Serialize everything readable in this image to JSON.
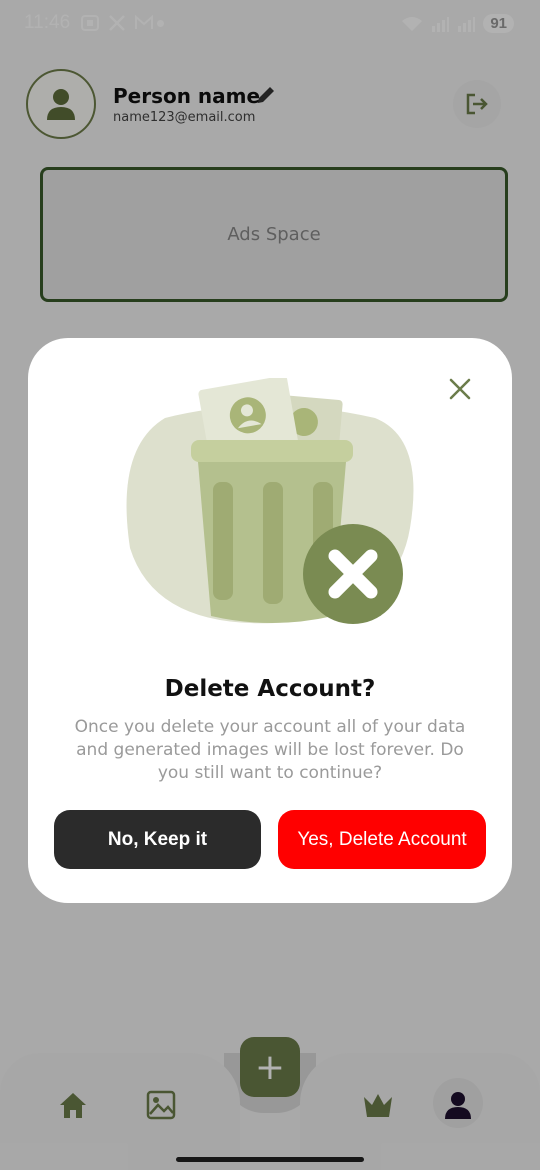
{
  "status_bar": {
    "time": "11:46",
    "battery": "91"
  },
  "profile": {
    "name": "Person name",
    "email": "name123@email.com"
  },
  "ads": {
    "label": "Ads Space"
  },
  "dialog": {
    "title": "Delete Account?",
    "message": "Once you delete your account all of your data and generated images will be lost forever. Do you still want to continue?",
    "keep_label": "No, Keep it",
    "delete_label": "Yes, Delete Account"
  },
  "colors": {
    "accent": "#6b7c4a",
    "danger": "#ff0000",
    "dark_button": "#2b2b2b"
  },
  "nav": {
    "fab_label": "+"
  }
}
